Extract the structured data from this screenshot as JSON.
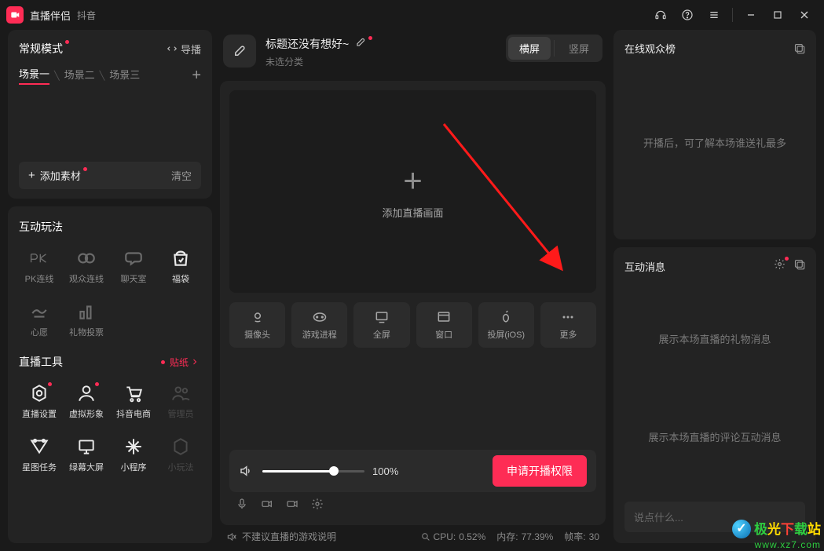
{
  "app": {
    "title": "直播伴侣",
    "subtitle": "抖音"
  },
  "left": {
    "mode_title": "常规模式",
    "director": "导播",
    "scenes": [
      "场景一",
      "场景二",
      "场景三"
    ],
    "add_material": "添加素材",
    "clear": "清空",
    "interact_title": "互动玩法",
    "interact_items": [
      {
        "label": "PK连线",
        "ico": "pk"
      },
      {
        "label": "观众连线",
        "ico": "link"
      },
      {
        "label": "聊天室",
        "ico": "chat"
      },
      {
        "label": "福袋",
        "ico": "bag",
        "active": true
      },
      {
        "label": "心愿",
        "ico": "wish"
      },
      {
        "label": "礼物投票",
        "ico": "vote"
      }
    ],
    "tools_title": "直播工具",
    "sticker": "贴纸",
    "tools_items": [
      {
        "label": "直播设置",
        "ico": "gear",
        "dot": true
      },
      {
        "label": "虚拟形象",
        "ico": "avatar",
        "dot": true
      },
      {
        "label": "抖音电商",
        "ico": "cart"
      },
      {
        "label": "管理员",
        "ico": "admin",
        "disabled": true
      },
      {
        "label": "星图任务",
        "ico": "star"
      },
      {
        "label": "绿幕大屏",
        "ico": "screen"
      },
      {
        "label": "小程序",
        "ico": "spark"
      },
      {
        "label": "小玩法",
        "ico": "play",
        "disabled": true
      }
    ]
  },
  "center": {
    "title": "标题还没有想好~",
    "category": "未选分类",
    "orient_h": "横屏",
    "orient_v": "竖屏",
    "canvas_hint": "添加直播画面",
    "sources": [
      {
        "label": "摄像头",
        "ico": "camera"
      },
      {
        "label": "游戏进程",
        "ico": "face"
      },
      {
        "label": "全屏",
        "ico": "monitor"
      },
      {
        "label": "窗口",
        "ico": "window"
      },
      {
        "label": "投屏(iOS)",
        "ico": "apple"
      },
      {
        "label": "更多",
        "ico": "dots"
      }
    ],
    "volume_pct": "100%",
    "apply_btn": "申请开播权限",
    "status_warn": "不建议直播的游戏说明",
    "cpu_label": "CPU:",
    "cpu_val": "0.52%",
    "mem_label": "内存:",
    "mem_val": "77.39%",
    "fps_label": "帧率:",
    "fps_val": "30"
  },
  "right": {
    "panel1_title": "在线观众榜",
    "panel1_hint": "开播后，可了解本场谁送礼最多",
    "panel2_title": "互动消息",
    "panel2_hint1": "展示本场直播的礼物消息",
    "panel2_hint2": "展示本场直播的评论互动消息",
    "chat_placeholder": "说点什么..."
  },
  "watermark": {
    "site_cn": "极光下载站",
    "url": "www.xz7.com"
  }
}
